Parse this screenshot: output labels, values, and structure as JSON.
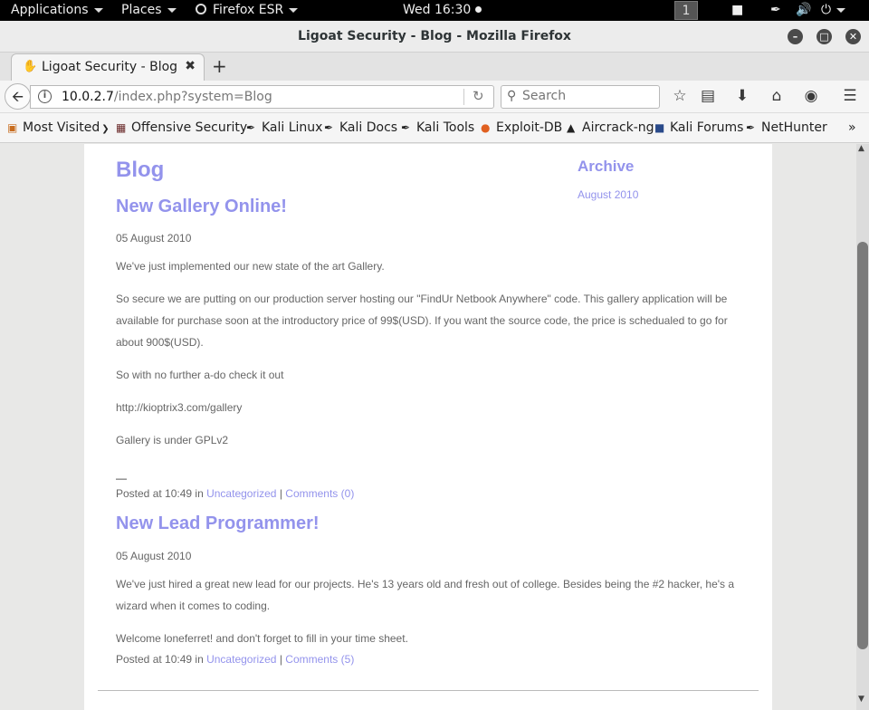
{
  "topbar": {
    "applications": "Applications",
    "places": "Places",
    "firefox_esr": "Firefox ESR",
    "clock": "Wed 16:30",
    "workspace": "1"
  },
  "window": {
    "title": "Ligoat Security - Blog - Mozilla Firefox"
  },
  "tab": {
    "title": "Ligoat Security - Blog"
  },
  "navbar": {
    "url_host": "10.0.2.7",
    "url_path": "/index.php?system=Blog",
    "search_placeholder": "Search"
  },
  "bookmarks": [
    {
      "label": "Most Visited",
      "icon": "most-visited-icon"
    },
    {
      "label": "Offensive Security",
      "icon": "offsec-icon"
    },
    {
      "label": "Kali Linux",
      "icon": "kali-icon"
    },
    {
      "label": "Kali Docs",
      "icon": "kali-icon"
    },
    {
      "label": "Kali Tools",
      "icon": "kali-icon"
    },
    {
      "label": "Exploit-DB",
      "icon": "exploit-db-icon"
    },
    {
      "label": "Aircrack-ng",
      "icon": "aircrack-icon"
    },
    {
      "label": "Kali Forums",
      "icon": "kali-forums-icon"
    },
    {
      "label": "NetHunter",
      "icon": "kali-icon"
    }
  ],
  "page": {
    "blog_title": "Blog",
    "archive_title": "Archive",
    "archive_link": "August 2010",
    "posts": [
      {
        "title": "New Gallery Online!",
        "date": "05 August 2010",
        "paragraphs": [
          "We've just implemented our new state of the art Gallery.",
          "So secure we are putting on our production server hosting our \"FindUr Netbook Anywhere\" code. This gallery application will be available for purchase soon at the introductory price of 99$(USD). If you want the source code, the price is schedualed to go for about 900$(USD).",
          "So with no further a-do check it out",
          "http://kioptrix3.com/gallery",
          "Gallery is under GPLv2",
          "—"
        ],
        "posted_prefix": "Posted at 10:49 in",
        "category": "Uncategorized",
        "separator": "|",
        "comments": "Comments (0)"
      },
      {
        "title": "New Lead Programmer!",
        "date": "05 August 2010",
        "paragraphs": [
          "We've just hired a great new lead for our projects. He's 13 years old and fresh out of college. Besides being the #2 hacker, he's a wizard when it comes to coding.",
          "Welcome loneferret! and don't forget to fill in your time sheet."
        ],
        "posted_prefix": "Posted at 10:49 in",
        "category": "Uncategorized",
        "separator": "|",
        "comments": "Comments (5)"
      }
    ]
  }
}
